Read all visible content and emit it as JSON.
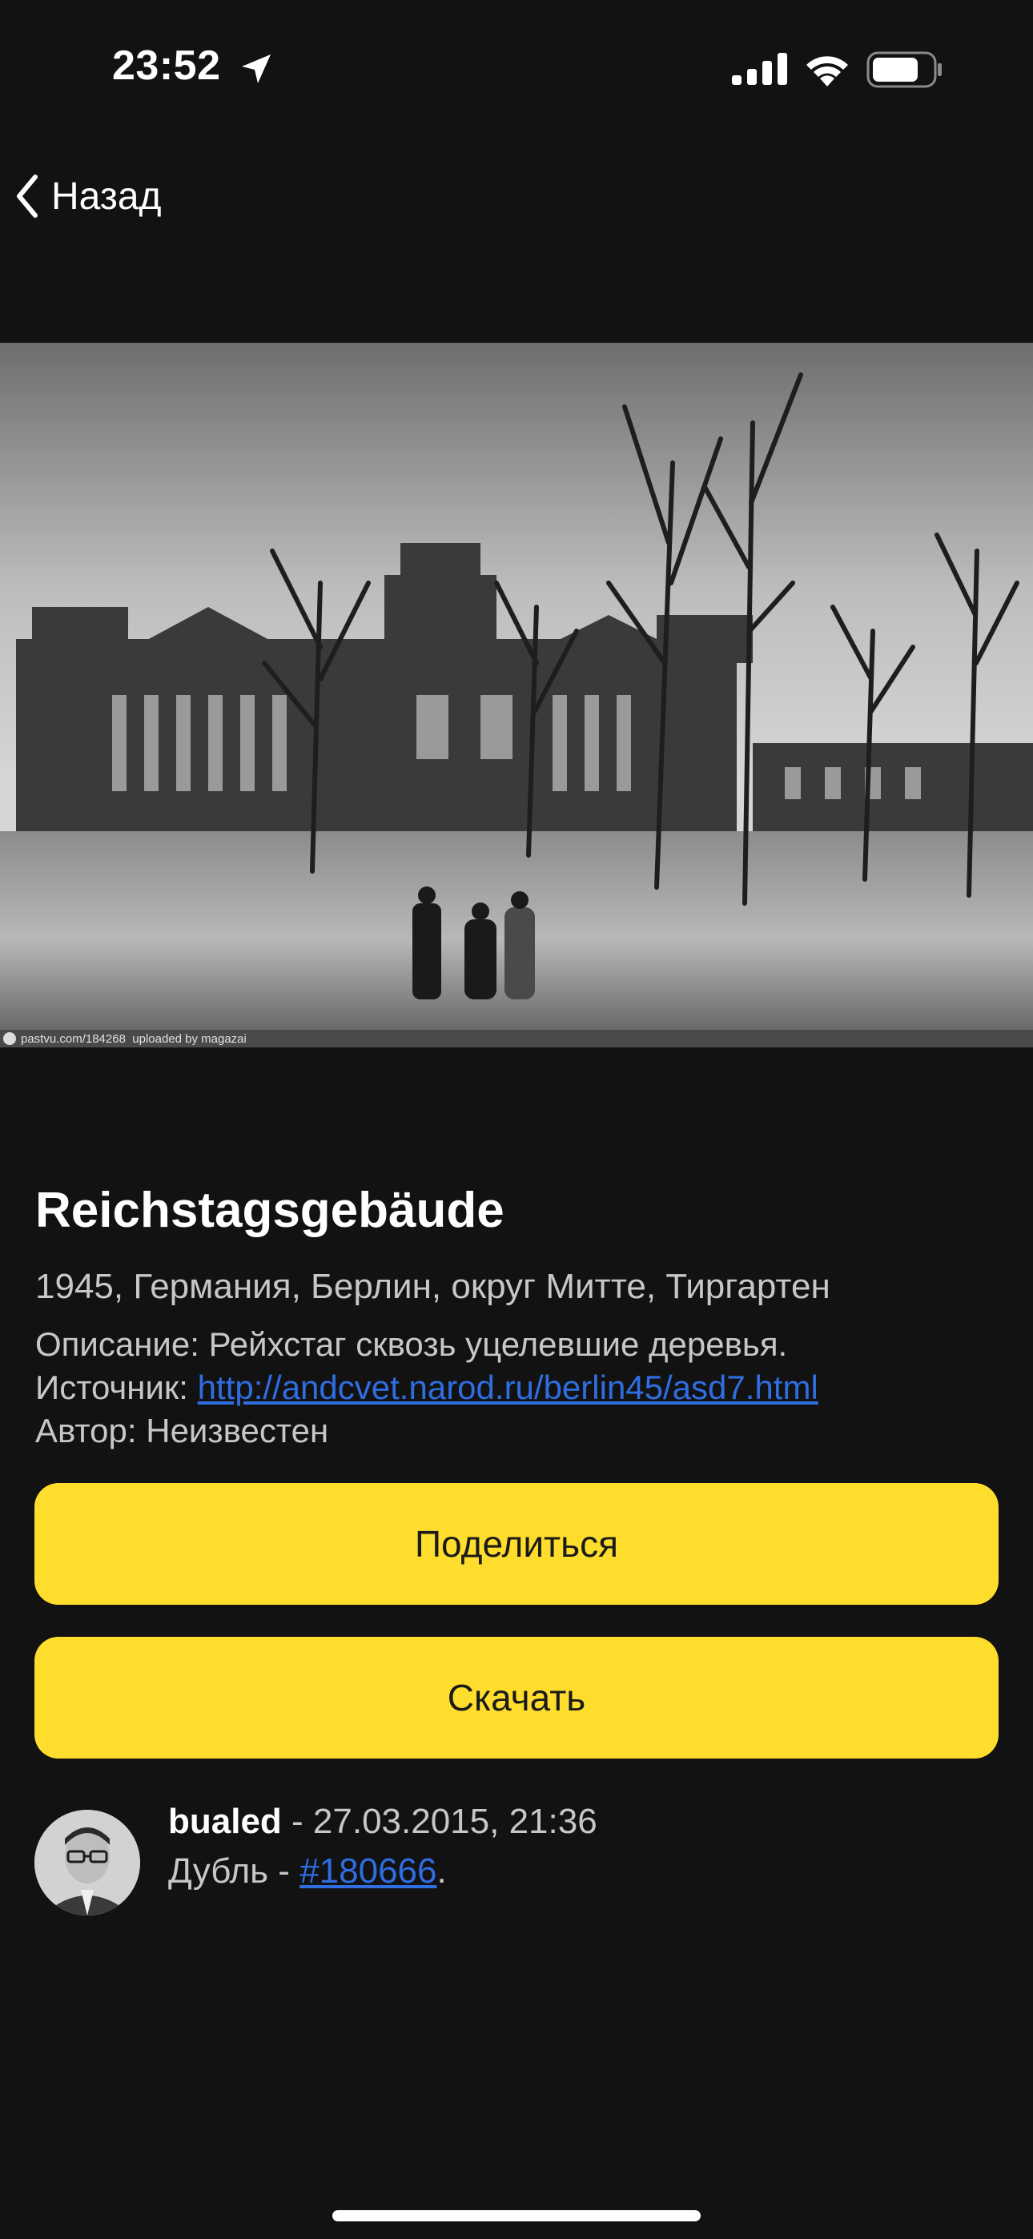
{
  "status_bar": {
    "time": "23:52"
  },
  "nav": {
    "back_label": "Назад"
  },
  "photo": {
    "credit": "pastvu.com/184268  uploaded by magazai"
  },
  "info": {
    "title": "Reichstagsgebäude",
    "meta": "1945, Германия, Берлин, округ Митте, Тиргартен",
    "description_label": "Описание:",
    "description_value": "Рейхстаг сквозь уцелевшие деревья.",
    "source_label": "Источник:",
    "source_url": "http://andcvet.narod.ru/berlin45/asd7.html",
    "author_label": "Автор:",
    "author_value": "Неизвестен"
  },
  "actions": {
    "share_label": "Поделиться",
    "download_label": "Скачать"
  },
  "comment": {
    "username": "bualed",
    "separator": " - ",
    "timestamp": "27.03.2015, 21:36",
    "text_prefix": "Дубль - ",
    "ref_link": "#180666",
    "text_suffix": "."
  },
  "colors": {
    "background": "#121212",
    "accent_button": "#ffdd2d",
    "link": "#2f6de1"
  },
  "icons": {
    "back": "chevron-left-icon",
    "location": "location-arrow-icon",
    "signal": "cellular-signal-icon",
    "wifi": "wifi-icon",
    "battery": "battery-icon"
  }
}
